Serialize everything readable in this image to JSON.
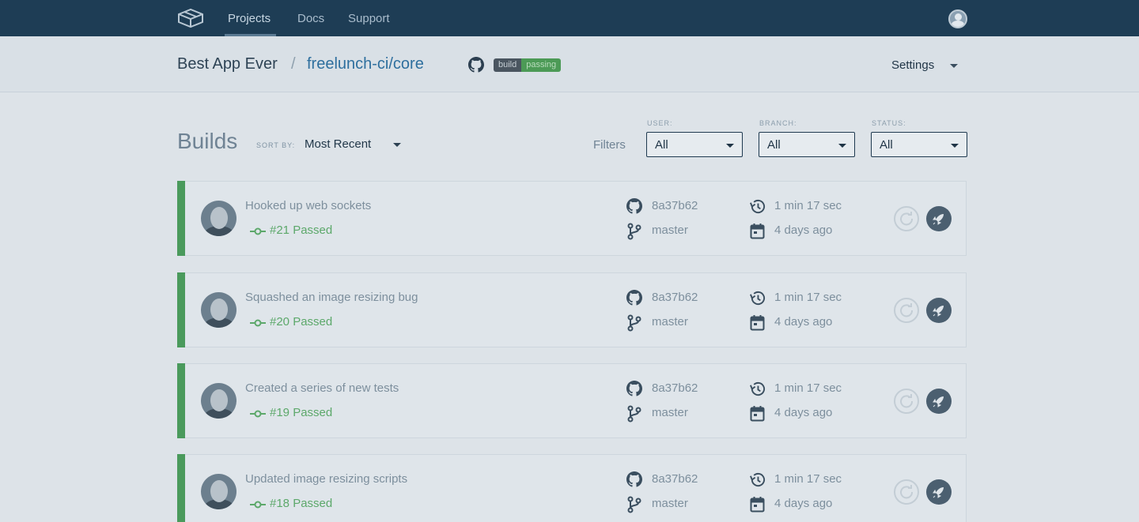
{
  "nav": {
    "items": [
      {
        "label": "Projects",
        "active": true
      },
      {
        "label": "Docs",
        "active": false
      },
      {
        "label": "Support",
        "active": false
      }
    ]
  },
  "project": {
    "app_name": "Best App Ever",
    "separator": "/",
    "repo": "freelunch-ci/core",
    "badge_left": "build",
    "badge_right": "passing",
    "settings_label": "Settings"
  },
  "builds": {
    "title": "Builds",
    "sort_label": "SORT BY:",
    "sort_value": "Most Recent",
    "filters_label": "Filters",
    "filters": [
      {
        "caption": "USER:",
        "value": "All"
      },
      {
        "caption": "BRANCH:",
        "value": "All"
      },
      {
        "caption": "STATUS:",
        "value": "All"
      }
    ],
    "rows": [
      {
        "message": "Hooked up web sockets",
        "status": "#21 Passed",
        "sha": "8a37b62",
        "branch": "master",
        "duration": "1 min 17 sec",
        "ago": "4 days ago"
      },
      {
        "message": "Squashed an image resizing bug",
        "status": "#20 Passed",
        "sha": "8a37b62",
        "branch": "master",
        "duration": "1 min 17 sec",
        "ago": "4 days ago"
      },
      {
        "message": "Created a series of new tests",
        "status": "#19 Passed",
        "sha": "8a37b62",
        "branch": "master",
        "duration": "1 min 17 sec",
        "ago": "4 days ago"
      },
      {
        "message": "Updated image resizing scripts",
        "status": "#18 Passed",
        "sha": "8a37b62",
        "branch": "master",
        "duration": "1 min 17 sec",
        "ago": "4 days ago"
      }
    ]
  },
  "colors": {
    "nav_bg": "#1e3d55",
    "passed": "#4a9a5c",
    "link": "#2e6f9e"
  }
}
